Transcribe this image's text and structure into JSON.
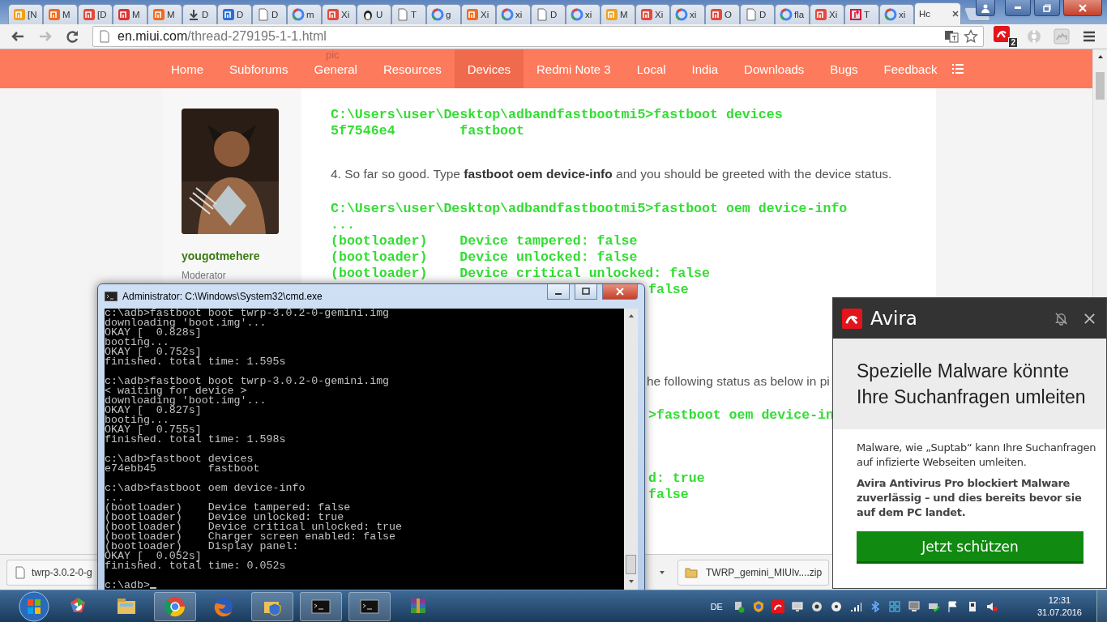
{
  "browser": {
    "tabs": [
      {
        "label": "[N",
        "selected": false
      },
      {
        "label": "M",
        "selected": false
      },
      {
        "label": "[D",
        "selected": false
      },
      {
        "label": "M",
        "selected": false
      },
      {
        "label": "M",
        "selected": false
      },
      {
        "label": "D",
        "selected": false
      },
      {
        "label": "D",
        "selected": false
      },
      {
        "label": "D",
        "selected": false
      },
      {
        "label": "m",
        "selected": false
      },
      {
        "label": "Xi",
        "selected": false
      },
      {
        "label": "U",
        "selected": false
      },
      {
        "label": "T",
        "selected": false
      },
      {
        "label": "g",
        "selected": false
      },
      {
        "label": "Xi",
        "selected": false
      },
      {
        "label": "xi",
        "selected": false
      },
      {
        "label": "D",
        "selected": false
      },
      {
        "label": "xi",
        "selected": false
      },
      {
        "label": "M",
        "selected": false
      },
      {
        "label": "Xi",
        "selected": false
      },
      {
        "label": "xi",
        "selected": false
      },
      {
        "label": "O",
        "selected": false
      },
      {
        "label": "D",
        "selected": false
      },
      {
        "label": "fla",
        "selected": false
      },
      {
        "label": "Xi",
        "selected": false
      },
      {
        "label": "T",
        "selected": false
      },
      {
        "label": "xi",
        "selected": false
      },
      {
        "label": "Hc",
        "selected": true
      }
    ],
    "address": {
      "host": "en.miui.com",
      "path": "/thread-279195-1-1.html"
    },
    "extension_badge": "2",
    "faded_text": "pic",
    "nav": [
      {
        "label": "Home",
        "selected": false
      },
      {
        "label": "Subforums",
        "selected": false
      },
      {
        "label": "General",
        "selected": false
      },
      {
        "label": "Resources",
        "selected": false
      },
      {
        "label": "Devices",
        "selected": true
      },
      {
        "label": "Redmi Note 3",
        "selected": false
      },
      {
        "label": "Local",
        "selected": false
      },
      {
        "label": "India",
        "selected": false
      },
      {
        "label": "Downloads",
        "selected": false
      },
      {
        "label": "Bugs",
        "selected": false
      },
      {
        "label": "Feedback",
        "selected": false
      }
    ],
    "sidebar": {
      "username": "yougotmehere",
      "role": "Moderator"
    },
    "post": [
      {
        "kind": "code",
        "lines": [
          "C:\\Users\\user\\Desktop\\adbandfastbootmi5>fastboot devices",
          "5f7546e4        fastboot"
        ]
      },
      {
        "kind": "text",
        "text": "4. So far so good. Type **fastboot oem device-info** and you should be greeted with the device status."
      },
      {
        "kind": "code",
        "lines": [
          "C:\\Users\\user\\Desktop\\adbandfastbootmi5>fastboot oem device-info",
          "...",
          "(bootloader)    Device tampered: false",
          "(bootloader)    Device unlocked: false",
          "(bootloader)    Device critical unlocked: false"
        ]
      },
      {
        "kind": "code_tail",
        "lines": [
          "false"
        ]
      },
      {
        "kind": "text_tail",
        "text": "he following status as below in pi"
      },
      {
        "kind": "code_tail",
        "lines": [
          ">fastboot oem device-in"
        ]
      },
      {
        "kind": "code_tail",
        "lines": [
          "d: true",
          "false"
        ]
      }
    ],
    "downloads": [
      {
        "label": "twrp-3.0.2-0-g"
      },
      {
        "label": "TWRP_gemini_MIUIv....zip"
      }
    ]
  },
  "console": {
    "title": "Administrator: C:\\Windows\\System32\\cmd.exe",
    "blocks": [
      [
        "c:\\adb>fastboot boot twrp-3.0.2-0-gemini.img",
        "downloading 'boot.img'...",
        "OKAY [  0.828s]",
        "booting...",
        "OKAY [  0.752s]",
        "finished. total time: 1.595s"
      ],
      [
        "c:\\adb>fastboot boot twrp-3.0.2-0-gemini.img",
        "< waiting for device >",
        "downloading 'boot.img'...",
        "OKAY [  0.827s]",
        "booting...",
        "OKAY [  0.755s]",
        "finished. total time: 1.598s"
      ],
      [
        "c:\\adb>fastboot devices",
        "e74ebb45        fastboot"
      ],
      [
        "c:\\adb>fastboot oem device-info",
        "...",
        "(bootloader)    Device tampered: false",
        "(bootloader)    Device unlocked: true",
        "(bootloader)    Device critical unlocked: true",
        "(bootloader)    Charger screen enabled: false",
        "(bootloader)    Display panel:",
        "OKAY [  0.052s]",
        "finished. total time: 0.052s"
      ]
    ],
    "prompt": "c:\\adb>"
  },
  "popup": {
    "brand": "Avira",
    "headline": "Spezielle Malware könnte Ihre Suchanfragen umleiten",
    "body": "Malware, wie „Suptab“ kann Ihre Suchanfragen auf infizierte Webseiten umleiten.",
    "emphasis": "Avira Antivirus Pro blockiert Malware zuverlässig – und dies bereits bevor sie auf dem PC landet.",
    "button": "Jetzt schützen"
  },
  "taskbar": {
    "language": "DE",
    "time": "12:31",
    "date": "31.07.2016"
  }
}
